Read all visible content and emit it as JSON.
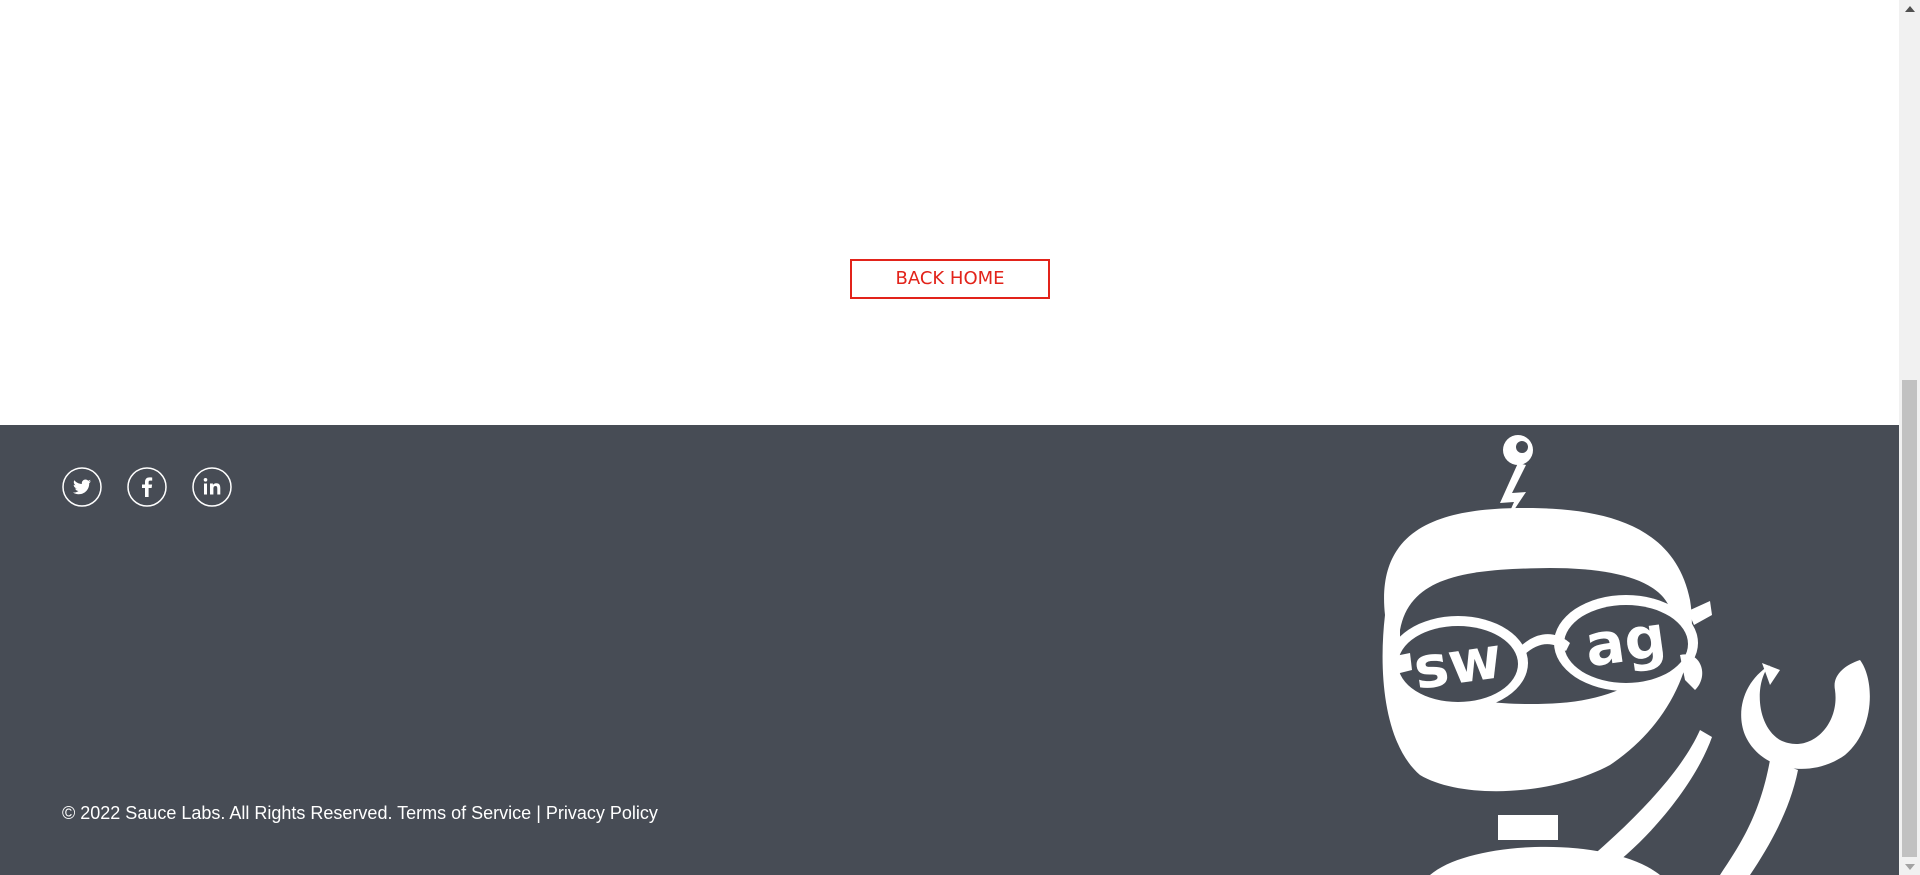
{
  "main": {
    "back_home_label": "BACK HOME"
  },
  "footer": {
    "social": [
      {
        "name": "twitter",
        "icon": "twitter-icon"
      },
      {
        "name": "facebook",
        "icon": "facebook-icon"
      },
      {
        "name": "linkedin",
        "icon": "linkedin-icon"
      }
    ],
    "copyright": "© 2022 Sauce Labs. All Rights Reserved.",
    "terms_label": "Terms of Service",
    "separator": "|",
    "privacy_label": "Privacy Policy",
    "robot_glasses_left": "sw",
    "robot_glasses_right": "ag"
  },
  "colors": {
    "accent": "#e2231a",
    "footer_bg": "#474c55",
    "footer_text": "#ffffff"
  }
}
